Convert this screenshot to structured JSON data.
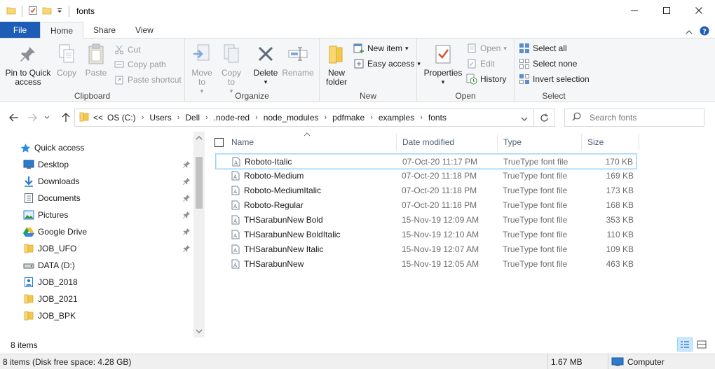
{
  "window": {
    "title": "fonts"
  },
  "ribbon_tabs": [
    "File",
    "Home",
    "Share",
    "View"
  ],
  "ribbon": {
    "clipboard": {
      "label": "Clipboard",
      "pin_quick": "Pin to Quick access",
      "copy": "Copy",
      "paste": "Paste",
      "cut": "Cut",
      "copy_path": "Copy path",
      "paste_shortcut": "Paste shortcut"
    },
    "organize": {
      "label": "Organize",
      "move_to": "Move to",
      "copy_to": "Copy to",
      "delete": "Delete",
      "rename": "Rename"
    },
    "new": {
      "label": "New",
      "new_folder": "New folder",
      "new_item": "New item",
      "easy_access": "Easy access"
    },
    "open": {
      "label": "Open",
      "properties": "Properties",
      "open": "Open",
      "edit": "Edit",
      "history": "History"
    },
    "select": {
      "label": "Select",
      "select_all": "Select all",
      "select_none": "Select none",
      "invert_selection": "Invert selection"
    }
  },
  "address": {
    "overflow": "<<",
    "crumbs": [
      "OS (C:)",
      "Users",
      "Dell",
      ".node-red",
      "node_modules",
      "pdfmake",
      "examples",
      "fonts"
    ]
  },
  "search": {
    "placeholder": "Search fonts"
  },
  "nav": {
    "items": [
      {
        "label": "Quick access",
        "icon": "star-icon",
        "pinned": false
      },
      {
        "label": "Desktop",
        "icon": "desktop-icon",
        "pinned": true
      },
      {
        "label": "Downloads",
        "icon": "download-icon",
        "pinned": true
      },
      {
        "label": "Documents",
        "icon": "document-icon",
        "pinned": true
      },
      {
        "label": "Pictures",
        "icon": "pictures-icon",
        "pinned": true
      },
      {
        "label": "Google Drive",
        "icon": "google-drive-icon",
        "pinned": true
      },
      {
        "label": "JOB_UFO",
        "icon": "folder-icon",
        "pinned": true
      },
      {
        "label": "DATA (D:)",
        "icon": "drive-icon",
        "pinned": false
      },
      {
        "label": "JOB_2018",
        "icon": "user-folder-icon",
        "pinned": false
      },
      {
        "label": "JOB_2021",
        "icon": "folder-icon",
        "pinned": false
      },
      {
        "label": "JOB_BPK",
        "icon": "folder-icon",
        "pinned": false
      }
    ]
  },
  "columns": {
    "name": "Name",
    "date": "Date modified",
    "type": "Type",
    "size": "Size"
  },
  "files": [
    {
      "name": "Roboto-Italic",
      "date": "07-Oct-20 11:17 PM",
      "type": "TrueType font file",
      "size": "170 KB"
    },
    {
      "name": "Roboto-Medium",
      "date": "07-Oct-20 11:18 PM",
      "type": "TrueType font file",
      "size": "169 KB"
    },
    {
      "name": "Roboto-MediumItalic",
      "date": "07-Oct-20 11:18 PM",
      "type": "TrueType font file",
      "size": "173 KB"
    },
    {
      "name": "Roboto-Regular",
      "date": "07-Oct-20 11:18 PM",
      "type": "TrueType font file",
      "size": "168 KB"
    },
    {
      "name": "THSarabunNew Bold",
      "date": "15-Nov-19 12:09 AM",
      "type": "TrueType font file",
      "size": "353 KB"
    },
    {
      "name": "THSarabunNew BoldItalic",
      "date": "15-Nov-19 12:10 AM",
      "type": "TrueType font file",
      "size": "110 KB"
    },
    {
      "name": "THSarabunNew Italic",
      "date": "15-Nov-19 12:07 AM",
      "type": "TrueType font file",
      "size": "109 KB"
    },
    {
      "name": "THSarabunNew",
      "date": "15-Nov-19 12:05 AM",
      "type": "TrueType font file",
      "size": "463 KB"
    }
  ],
  "status": {
    "item_count": "8 items",
    "disk_info": "8 items (Disk free space: 4.28 GB)",
    "size": "1.67 MB",
    "location": "Computer"
  },
  "colors": {
    "accent": "#1e5db5",
    "selection": "#cce8ff",
    "folder": "#f8d775"
  }
}
